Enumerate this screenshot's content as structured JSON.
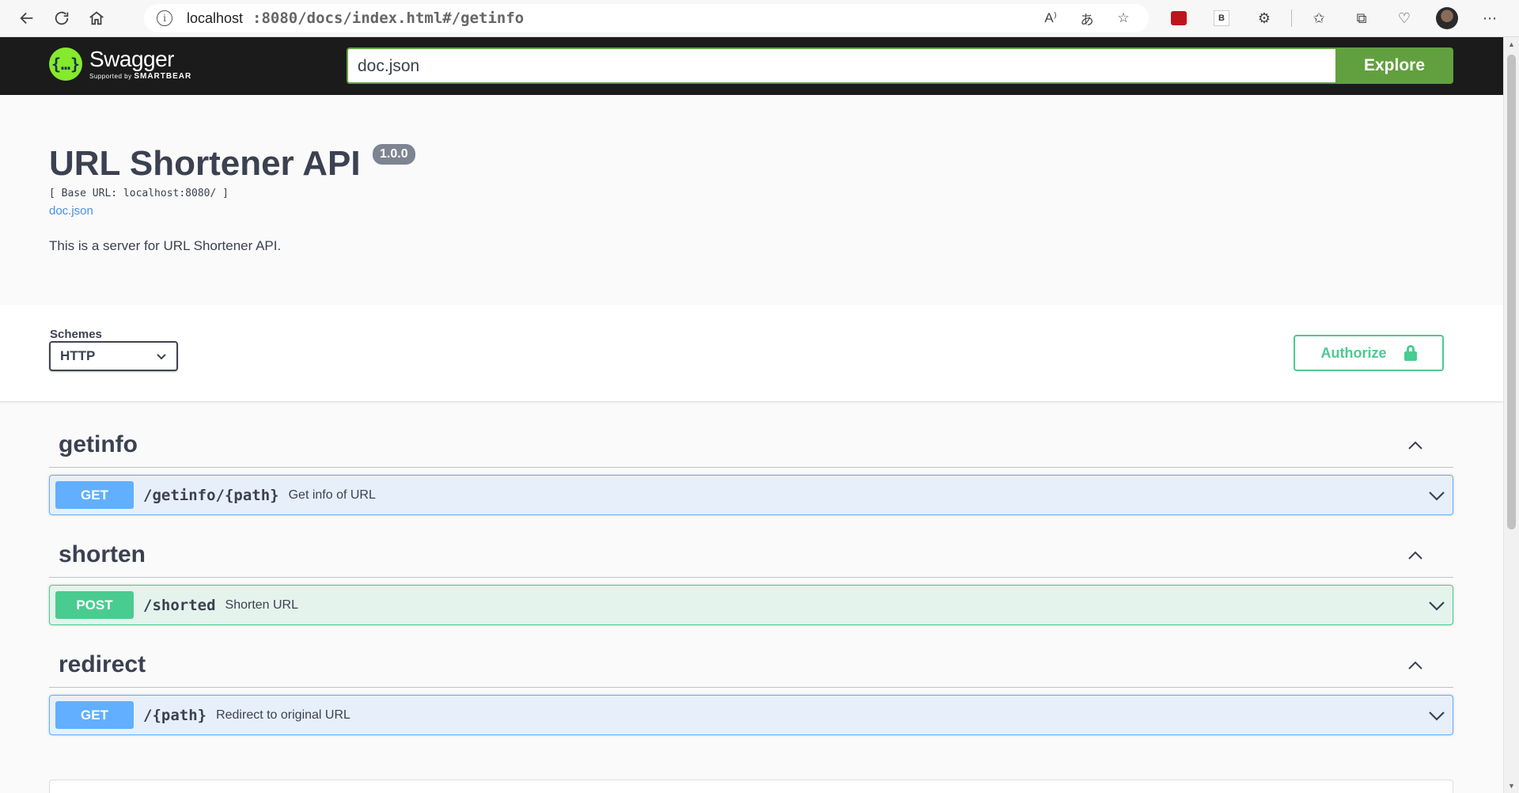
{
  "browser": {
    "url_host": "localhost",
    "url_path": ":8080/docs/index.html#/getinfo"
  },
  "swagger": {
    "logo_text": "Swagger",
    "logo_sub_prefix": "Supported by",
    "logo_sub_brand": "SMARTBEAR",
    "spec_url": "doc.json",
    "explore_label": "Explore"
  },
  "info": {
    "title": "URL Shortener API",
    "version": "1.0.0",
    "base_url": "[ Base URL: localhost:8080/ ]",
    "doc_link": "doc.json",
    "description": "This is a server for URL Shortener API."
  },
  "schemes": {
    "label": "Schemes",
    "selected": "HTTP",
    "authorize_label": "Authorize"
  },
  "tags": [
    {
      "name": "getinfo",
      "operation": {
        "method": "GET",
        "path": "/getinfo/{path}",
        "summary": "Get info of URL"
      }
    },
    {
      "name": "shorten",
      "operation": {
        "method": "POST",
        "path": "/shorted",
        "summary": "Shorten URL"
      }
    },
    {
      "name": "redirect",
      "operation": {
        "method": "GET",
        "path": "/{path}",
        "summary": "Redirect to original URL"
      }
    }
  ],
  "colors": {
    "get": "#61affe",
    "post": "#49cc90",
    "explore": "#62a03f"
  }
}
